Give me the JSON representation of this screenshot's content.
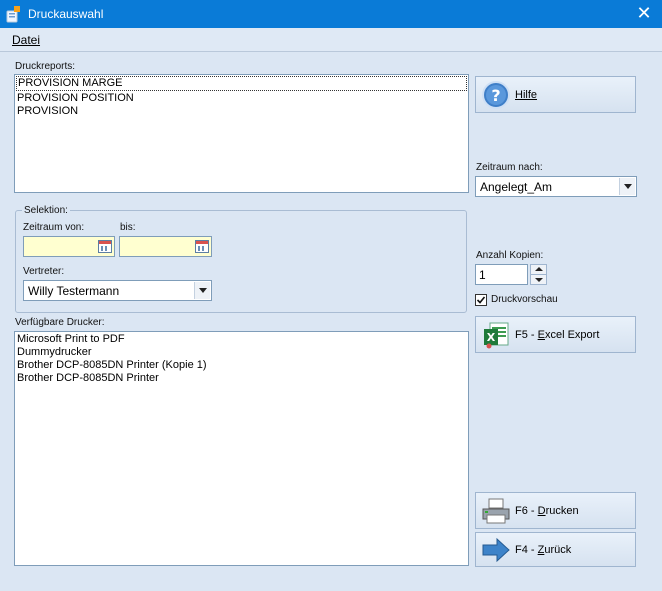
{
  "window": {
    "title": "Druckauswahl",
    "close_glyph": "✕"
  },
  "menu": {
    "items": [
      {
        "label": "Datei"
      }
    ]
  },
  "druckreports": {
    "label": "Druckreports:",
    "items": [
      "PROVISION MARGE",
      "PROVISION POSITION",
      "PROVISION"
    ],
    "selected_index": 0
  },
  "help_button": {
    "label": "Hilfe",
    "icon": "help-icon"
  },
  "zeitraum_nach": {
    "label": "Zeitraum nach:",
    "value": "Angelegt_Am"
  },
  "selektion": {
    "title": "Selektion:",
    "zeitraum_von_label": "Zeitraum von:",
    "bis_label": "bis:",
    "zeitraum_von_value": "",
    "bis_value": "",
    "vertreter_label": "Vertreter:",
    "vertreter_value": "Willy Testermann"
  },
  "anzahl_kopien": {
    "label": "Anzahl Kopien:",
    "value": "1"
  },
  "druckvorschau": {
    "label": "Druckvorschau",
    "checked": true
  },
  "drucker": {
    "label": "Verfügbare Drucker:",
    "items": [
      "Microsoft Print to PDF",
      "Dummydrucker",
      "Brother DCP-8085DN Printer (Kopie 1)",
      "Brother DCP-8085DN Printer"
    ]
  },
  "buttons": {
    "excel_export": {
      "label": "F5 - Excel Export",
      "icon": "excel-icon"
    },
    "drucken": {
      "label": "F6 - Drucken",
      "icon": "printer-icon"
    },
    "zurueck": {
      "label": "F4 - Zurück",
      "icon": "arrow-right-icon"
    }
  },
  "colors": {
    "titlebar": "#0a7bd7",
    "background": "#dbe6f3",
    "date_field": "#ffffd0"
  }
}
